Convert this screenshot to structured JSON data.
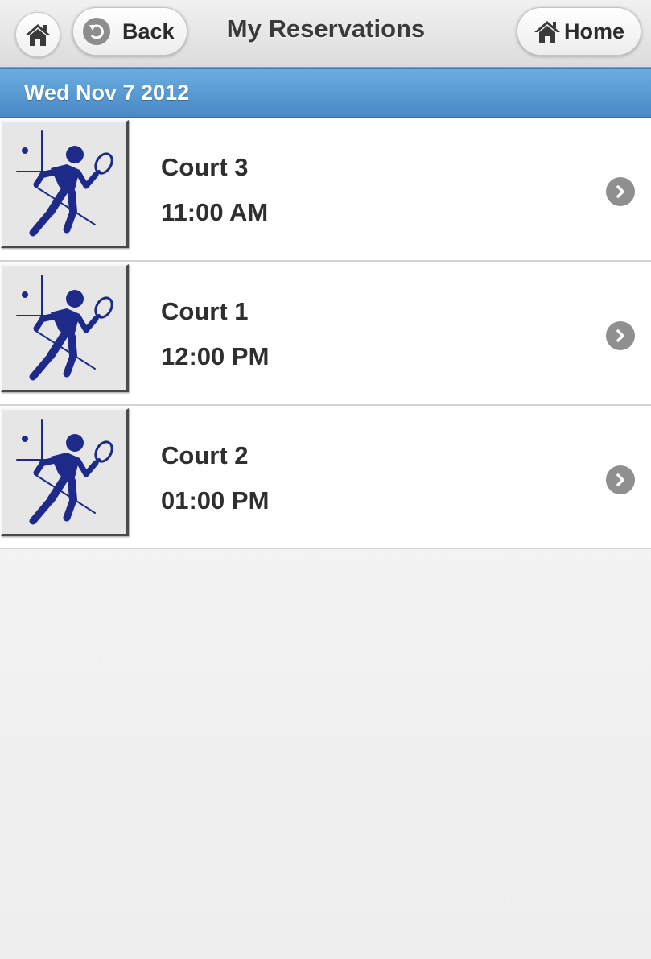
{
  "header": {
    "title": "My Reservations",
    "back_label": "Back",
    "home_label": "Home"
  },
  "divider": {
    "date": "Wed Nov 7 2012"
  },
  "reservations": [
    {
      "court": "Court 3",
      "time": "11:00 AM"
    },
    {
      "court": "Court 1",
      "time": "12:00 PM"
    },
    {
      "court": "Court 2",
      "time": "01:00 PM"
    }
  ],
  "icons": {
    "home": "home-icon",
    "back": "back-arrow-icon",
    "item_thumb": "racquetball-player-icon",
    "chevron": "chevron-right-icon"
  },
  "colors": {
    "divider_blue": "#5a9ad4",
    "player_navy": "#1e2a8a"
  }
}
